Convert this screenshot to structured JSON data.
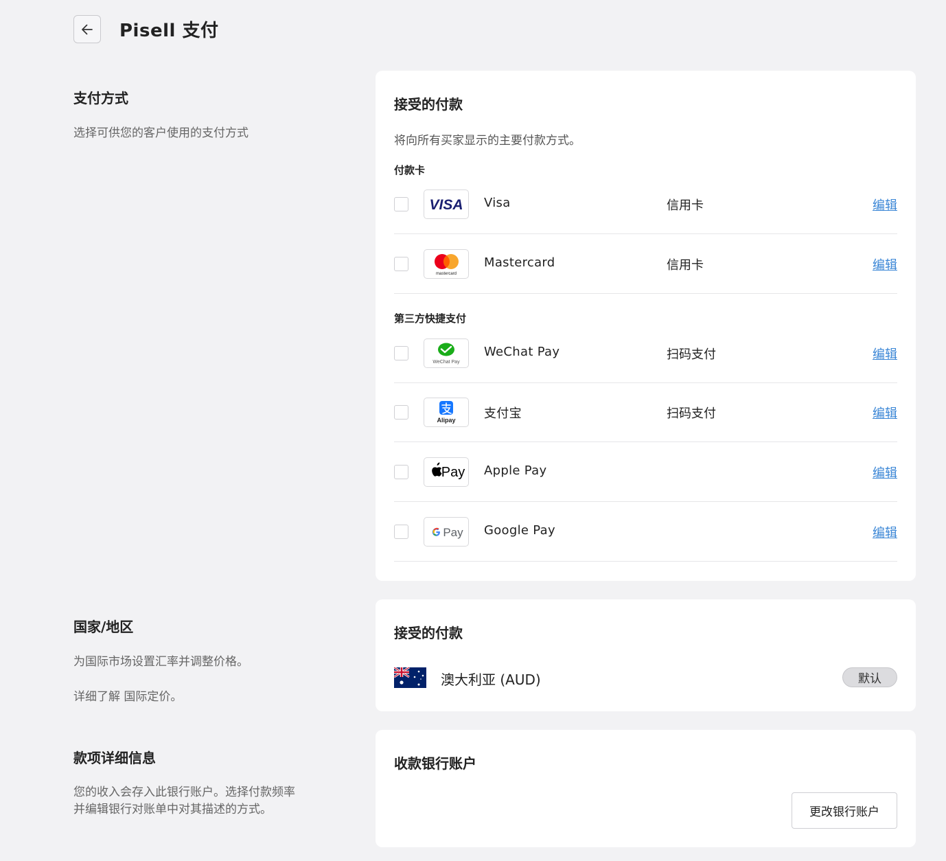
{
  "header": {
    "title": "Pisell 支付"
  },
  "payment_section": {
    "title": "支付方式",
    "description": "选择可供您的客户使用的支付方式",
    "card_title": "接受的付款",
    "card_subtitle": "将向所有买家显示的主要付款方式。",
    "groups": [
      {
        "label": "付款卡",
        "methods": [
          {
            "name": "Visa",
            "type": "信用卡",
            "edit": "编辑",
            "logo_text": "VISA",
            "icon": "visa-logo-icon",
            "checked": false
          },
          {
            "name": "Mastercard",
            "type": "信用卡",
            "edit": "编辑",
            "logo_text": "mastercard",
            "icon": "mastercard-logo-icon",
            "checked": false
          }
        ]
      },
      {
        "label": "第三方快捷支付",
        "methods": [
          {
            "name": "WeChat Pay",
            "type": "扫码支付",
            "edit": "编辑",
            "logo_text": "WeChat Pay",
            "icon": "wechat-pay-logo-icon",
            "checked": false
          },
          {
            "name": "支付宝",
            "type": "扫码支付",
            "edit": "编辑",
            "logo_text": "Alipay",
            "icon": "alipay-logo-icon",
            "checked": false
          },
          {
            "name": "Apple Pay",
            "type": "",
            "edit": "编辑",
            "logo_text": "Pay",
            "icon": "apple-pay-logo-icon",
            "checked": false
          },
          {
            "name": "Google Pay",
            "type": "",
            "edit": "编辑",
            "logo_text": "Pay",
            "icon": "google-pay-logo-icon",
            "checked": false
          }
        ]
      }
    ]
  },
  "country_section": {
    "title": "国家/地区",
    "description_line1": "为国际市场设置汇率并调整价格。",
    "description_line2": "详细了解 国际定价。",
    "card_title": "接受的付款",
    "country": {
      "name": "澳大利亚 (AUD)",
      "badge": "默认",
      "icon": "australia-flag-icon"
    }
  },
  "payout_section": {
    "title": "款项详细信息",
    "description_line1": "您的收入会存入此银行账户。选择付款频率",
    "description_line2": "并编辑银行对账单中对其描述的方式。",
    "card_title": "收款银行账户",
    "change_button": "更改银行账户"
  },
  "colors": {
    "background": "#f2f2f4",
    "card": "#ffffff",
    "link": "#3a86d6",
    "visa_blue": "#1a1f71",
    "mastercard_red": "#eb001b",
    "mastercard_orange": "#f79e1b",
    "wechat_green": "#1aad19",
    "alipay_blue": "#1677ff"
  }
}
